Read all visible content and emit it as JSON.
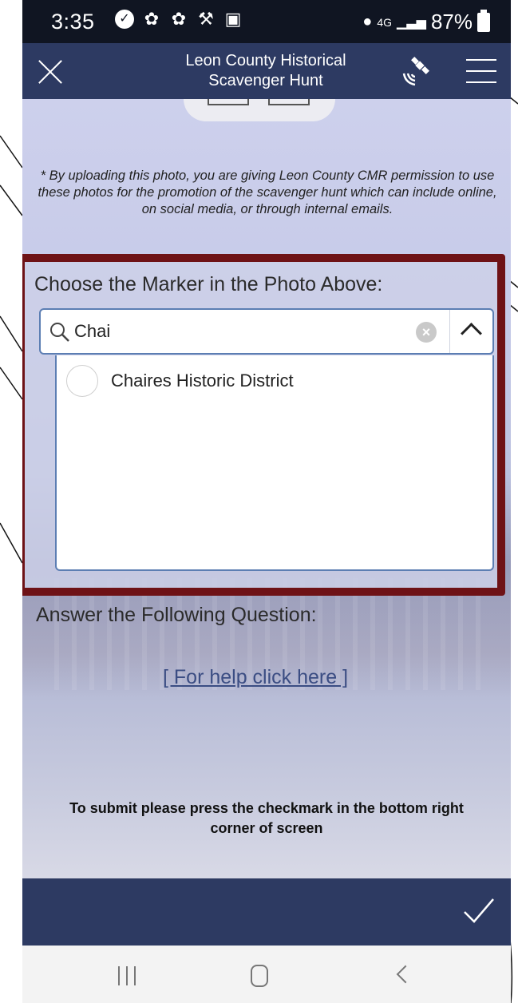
{
  "statusbar": {
    "time": "3:35",
    "signal_text": "4G",
    "battery": "87%"
  },
  "appbar": {
    "title": "Leon County Historical Scavenger Hunt",
    "close_icon": "close-icon",
    "gps_icon": "satellite-gps-icon",
    "menu_icon": "hamburger-menu-icon"
  },
  "form": {
    "disclaimer": "* By uploading this photo, you are giving Leon County CMR permission to use these photos for the promotion of the scavenger hunt which can include online, on social media, or through internal emails.",
    "marker_label": "Choose the Marker in the Photo Above:",
    "search_value": "Chai",
    "options": [
      {
        "label": "Chaires Historic District"
      }
    ],
    "question_label": "Answer the Following Question:",
    "help_link": "[ For help click here ]",
    "submit_note": "To submit please press the checkmark in the bottom right corner of screen"
  },
  "colors": {
    "appbar": "#2d3a62",
    "highlight_border": "#6e1216",
    "link": "#3b4d83"
  }
}
